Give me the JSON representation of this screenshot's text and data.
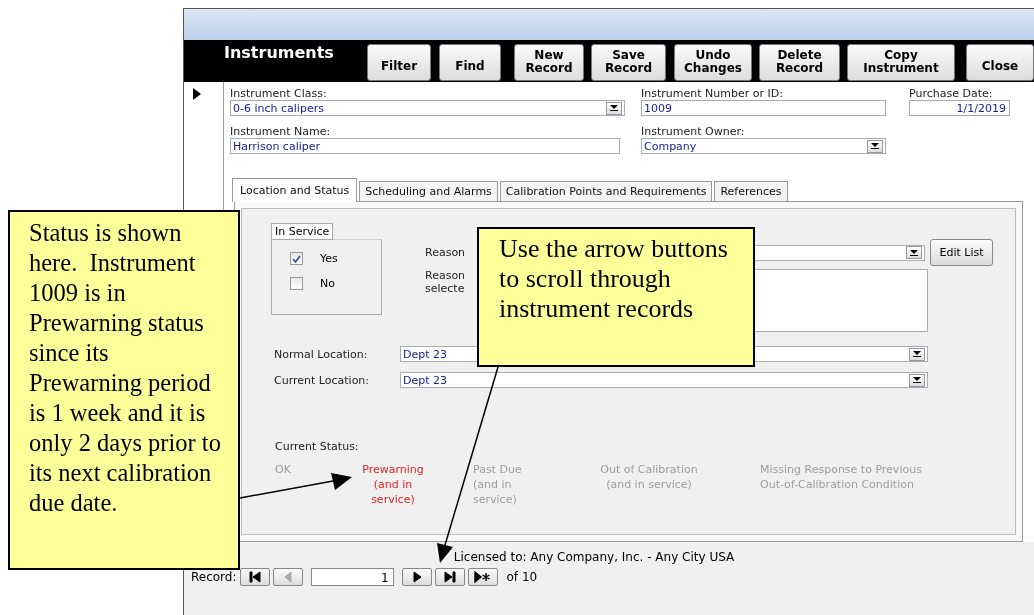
{
  "window": {
    "title": "Instruments"
  },
  "toolbar": [
    {
      "label": "Filter"
    },
    {
      "label": "Find"
    },
    {
      "label": "New\nRecord"
    },
    {
      "label": "Save\nRecord"
    },
    {
      "label": "Undo\nChanges"
    },
    {
      "label": "Delete\nRecord"
    },
    {
      "label": "Copy\nInstrument"
    },
    {
      "label": "Close"
    }
  ],
  "instrument_class": {
    "label": "Instrument Class:",
    "value": "0-6 inch calipers"
  },
  "instrument_number": {
    "label": "Instrument Number or ID:",
    "value": "1009"
  },
  "purchase_date": {
    "label": "Purchase Date:",
    "value": "1/1/2019"
  },
  "instrument_name": {
    "label": "Instrument Name:",
    "value": "Harrison caliper"
  },
  "instrument_owner": {
    "label": "Instrument Owner:",
    "value": "Company"
  },
  "tabs": [
    {
      "label": "Location and Status",
      "selected": true
    },
    {
      "label": "Scheduling and Alarms",
      "selected": false
    },
    {
      "label": "Calibration Points and Requirements",
      "selected": false
    },
    {
      "label": "References",
      "selected": false
    }
  ],
  "in_service": {
    "legend": "In Service",
    "options": [
      {
        "label": "Yes",
        "checked": true
      },
      {
        "label": "No",
        "checked": false
      }
    ]
  },
  "reason": {
    "label": "Reason",
    "button": "Edit List"
  },
  "reason_note": {
    "label": "Reason\nselecte"
  },
  "normal_location": {
    "label": "Normal Location:",
    "value": "Dept 23"
  },
  "current_location": {
    "label": "Current Location:",
    "value": "Dept 23"
  },
  "current_status": {
    "label": "Current Status:",
    "items": [
      {
        "text": "OK",
        "selected": false
      },
      {
        "text": "Prewarning\n(and in\nservice)",
        "selected": true
      },
      {
        "text": "Past Due\n(and in\nservice)",
        "selected": false
      },
      {
        "text": "Out of Calibration\n(and in service)",
        "selected": false
      },
      {
        "text": "Missing Response to Previous\nOut-of-Calibration Condition",
        "selected": false
      }
    ]
  },
  "license": "Licensed to: Any Company, Inc. - Any City USA",
  "record_nav": {
    "label": "Record:",
    "current": "1",
    "total": "of 10",
    "buttons": [
      {
        "kind": "first",
        "disabled": false
      },
      {
        "kind": "prev",
        "disabled": true
      },
      {
        "kind": "next",
        "disabled": false
      },
      {
        "kind": "last",
        "disabled": false
      },
      {
        "kind": "new",
        "disabled": false
      }
    ]
  },
  "callouts": [
    {
      "text": "Status is shown here.  Instrument 1009 is in Prewarning status since its Prewarning period is 1 week and it is only 2 days prior to its next calibration due date."
    },
    {
      "text": "Use the arrow buttons to scroll through instrument records"
    }
  ]
}
